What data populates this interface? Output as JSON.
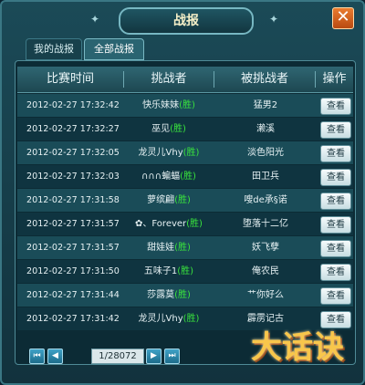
{
  "window": {
    "title": "战报",
    "close_symbol": "✕"
  },
  "tabs": [
    {
      "label": "我的战报"
    },
    {
      "label": "全部战报"
    }
  ],
  "table": {
    "headers": [
      "比赛时间",
      "挑战者",
      "被挑战者",
      "操作"
    ],
    "rows": [
      {
        "time": "2012-02-27  17:32:42",
        "challenger": "快乐妹妹",
        "win": "(胜)",
        "defender": "猛男2",
        "action": "查看"
      },
      {
        "time": "2012-02-27  17:32:27",
        "challenger": "巫见",
        "win": "(胜)",
        "defender": "濑溪",
        "action": "查看"
      },
      {
        "time": "2012-02-27  17:32:05",
        "challenger": "龙灵儿Vhy",
        "win": "(胜)",
        "defender": "淡色阳光",
        "action": "查看"
      },
      {
        "time": "2012-02-27  17:32:03",
        "challenger": "∩∩∩蝙蝠",
        "win": "(胜)",
        "defender": "田卫兵",
        "action": "查看"
      },
      {
        "time": "2012-02-27  17:31:58",
        "challenger": "萝缤翩",
        "win": "(胜)",
        "defender": "嗖de承§诺",
        "action": "查看"
      },
      {
        "time": "2012-02-27  17:31:57",
        "challenger": "✿、Forever",
        "win": "(胜)",
        "defender": "堕落十二亿",
        "action": "查看"
      },
      {
        "time": "2012-02-27  17:31:57",
        "challenger": "甜娃娃",
        "win": "(胜)",
        "defender": "妖飞孽",
        "action": "查看"
      },
      {
        "time": "2012-02-27  17:31:50",
        "challenger": "五味子1",
        "win": "(胜)",
        "defender": "俺农民",
        "action": "查看"
      },
      {
        "time": "2012-02-27  17:31:44",
        "challenger": "莎露莫",
        "win": "(胜)",
        "defender": "艹你好么",
        "action": "查看"
      },
      {
        "time": "2012-02-27  17:31:42",
        "challenger": "龙灵儿Vhy",
        "win": "(胜)",
        "defender": "霹雳记古",
        "action": "查看"
      }
    ]
  },
  "pager": {
    "first": "⏮",
    "prev": "◀",
    "info": "1/28072",
    "next": "▶",
    "last": "⏭"
  },
  "logo_text": "大话诀"
}
